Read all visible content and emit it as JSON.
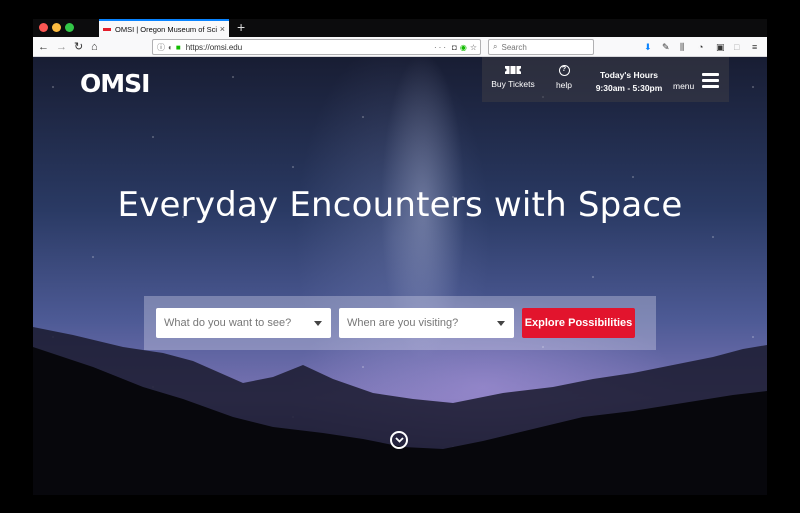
{
  "browser": {
    "tab_title": "OMSI | Oregon Museum of Scie",
    "tab_close": "×",
    "new_tab": "+",
    "url": "https://omsi.edu",
    "search_placeholder": "Search",
    "url_actions": "···",
    "accent_color": "#0a84ff"
  },
  "site": {
    "logo": "OMSI",
    "utility": {
      "buy_tickets": "Buy Tickets",
      "help": "help",
      "hours_title": "Today's Hours",
      "hours_value": "9:30am - 5:30pm",
      "menu": "menu"
    },
    "headline": "Everyday Encounters with Space",
    "search": {
      "what_placeholder": "What do you want to see?",
      "when_placeholder": "When are you visiting?",
      "button": "Explore Possibilities",
      "button_color": "#e2142d"
    },
    "icons": {
      "tickets": "ticket-icon",
      "help": "help-icon",
      "menu": "hamburger-menu-icon",
      "scroll": "chevron-down-circle-icon"
    }
  }
}
